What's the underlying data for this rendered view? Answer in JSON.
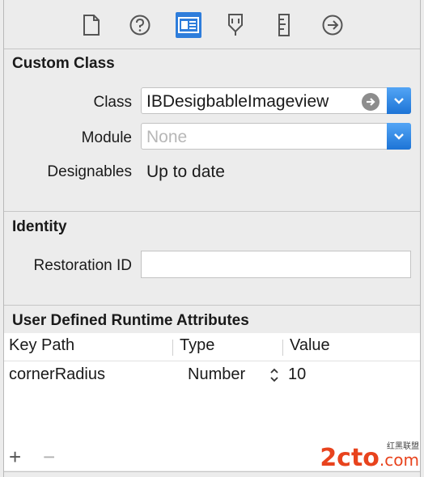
{
  "toolbar": {
    "tabs": [
      {
        "name": "file-inspector",
        "icon": "document-icon"
      },
      {
        "name": "quick-help",
        "icon": "question-icon"
      },
      {
        "name": "identity-inspector",
        "icon": "identity-card-icon",
        "selected": true
      },
      {
        "name": "attributes-inspector",
        "icon": "attributes-icon"
      },
      {
        "name": "size-inspector",
        "icon": "ruler-icon"
      },
      {
        "name": "connections-inspector",
        "icon": "arrow-circle-icon"
      }
    ]
  },
  "custom_class": {
    "title": "Custom Class",
    "class_label": "Class",
    "class_value": "IBDesigbableImageview",
    "module_label": "Module",
    "module_placeholder": "None",
    "designables_label": "Designables",
    "designables_value": "Up to date"
  },
  "identity": {
    "title": "Identity",
    "restoration_label": "Restoration ID",
    "restoration_value": ""
  },
  "runtime_attributes": {
    "title": "User Defined Runtime Attributes",
    "columns": [
      "Key Path",
      "Type",
      "Value"
    ],
    "rows": [
      {
        "key_path": "cornerRadius",
        "type": "Number",
        "value": "10"
      }
    ],
    "add_label": "+",
    "remove_label": "−"
  },
  "watermark": {
    "text1": "2cto",
    "text2": ".com",
    "text3": "红黑联盟"
  },
  "colors": {
    "accent": "#2e7ddb",
    "watermark": "#e8431d"
  }
}
